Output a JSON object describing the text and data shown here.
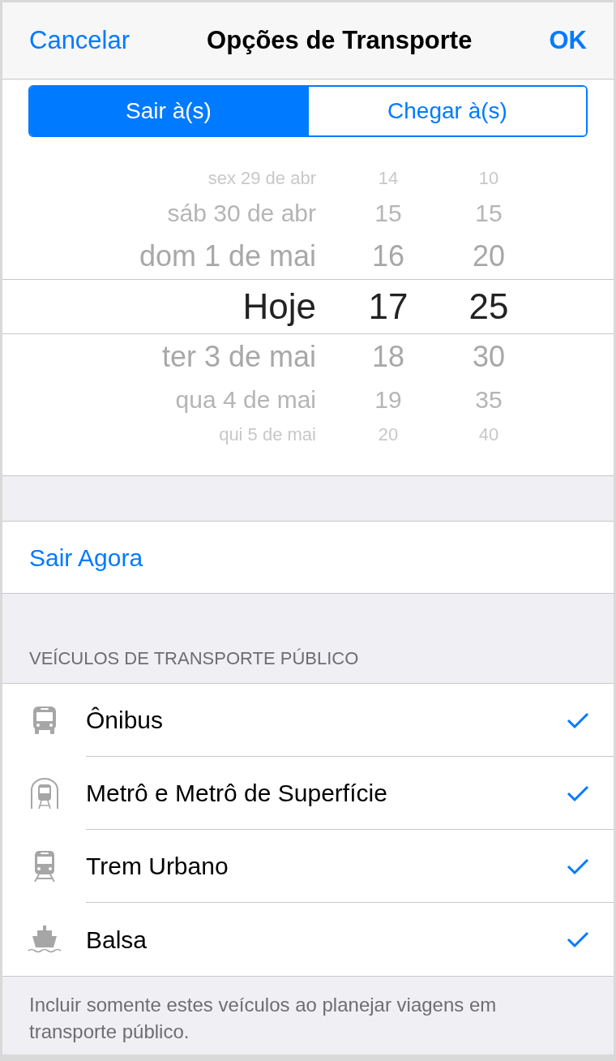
{
  "nav": {
    "cancel": "Cancelar",
    "title": "Opções de Transporte",
    "done": "OK"
  },
  "segments": [
    {
      "label": "Sair à(s)",
      "selected": true
    },
    {
      "label": "Chegar à(s)",
      "selected": false
    }
  ],
  "picker": {
    "rows": [
      {
        "date": "sex 29 de abr",
        "hour": "14",
        "minute": "10",
        "selected": false
      },
      {
        "date": "sáb 30 de abr",
        "hour": "15",
        "minute": "15",
        "selected": false
      },
      {
        "date": "dom 1 de mai",
        "hour": "16",
        "minute": "20",
        "selected": false
      },
      {
        "date": "Hoje",
        "hour": "17",
        "minute": "25",
        "selected": true
      },
      {
        "date": "ter 3 de mai",
        "hour": "18",
        "minute": "30",
        "selected": false
      },
      {
        "date": "qua 4 de mai",
        "hour": "19",
        "minute": "35",
        "selected": false
      },
      {
        "date": "qui 5 de mai",
        "hour": "20",
        "minute": "40",
        "selected": false
      }
    ]
  },
  "leave_now": "Sair Agora",
  "section_header": "VEÍCULOS DE TRANSPORTE PÚBLICO",
  "vehicles": [
    {
      "kind": "bus",
      "label": "Ônibus",
      "checked": true
    },
    {
      "kind": "subway",
      "label": "Metrô e Metrô de Superfície",
      "checked": true
    },
    {
      "kind": "train",
      "label": "Trem Urbano",
      "checked": true
    },
    {
      "kind": "ferry",
      "label": "Balsa",
      "checked": true
    }
  ],
  "footer": "Incluir somente estes veículos ao planejar viagens em transporte público."
}
